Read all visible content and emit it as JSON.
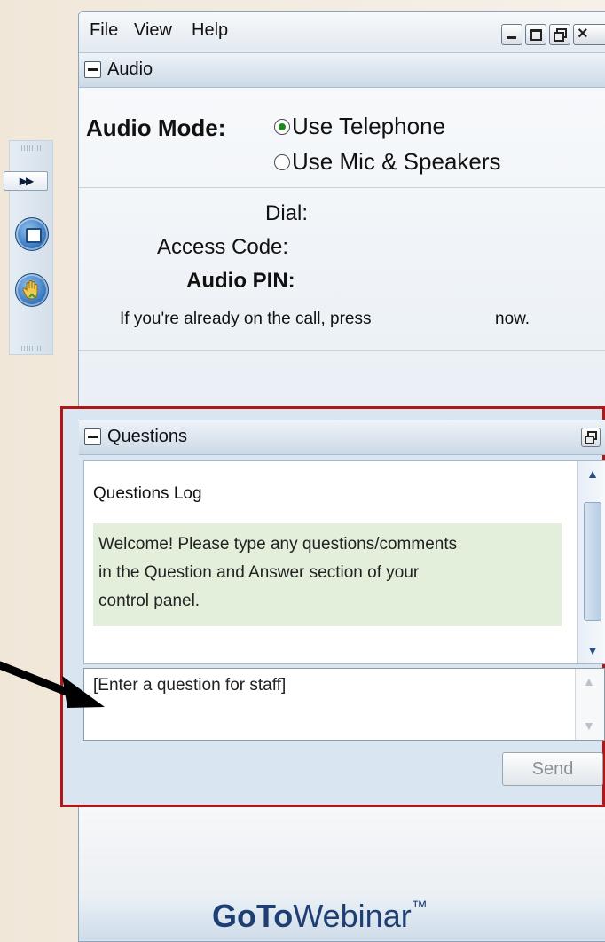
{
  "menu": [
    "File",
    "View",
    "Help"
  ],
  "audio": {
    "section_title": "Audio",
    "mode_label": "Audio Mode:",
    "options": [
      "Use Telephone",
      "Use Mic & Speakers"
    ],
    "selected_option": "Use Telephone",
    "dial_label": "Dial:",
    "access_code_label": "Access Code:",
    "pin_label": "Audio PIN:",
    "call_note_start": "If you're already on the call, press",
    "call_note_end": "now."
  },
  "questions": {
    "section_title": "Questions",
    "log_title": "Questions Log",
    "welcome_lines": [
      "Welcome! Please type any questions/comments",
      "in the Question and Answer section of your",
      "control panel."
    ],
    "entry_value": "[Enter a question for staff]",
    "send_label": "Send"
  },
  "branding": {
    "goto": "GoTo",
    "webinar": "Webinar",
    "tm": "™",
    "brand_color": "#1d3f73"
  },
  "icons": [
    "fast-forward-icon",
    "screen-icon",
    "raise-hand-icon",
    "minimize-icon",
    "maximize-icon",
    "restore-icon",
    "close-icon",
    "collapse-icon",
    "popout-icon",
    "scroll-up-icon",
    "scroll-down-icon",
    "pointer-arrow-icon"
  ]
}
